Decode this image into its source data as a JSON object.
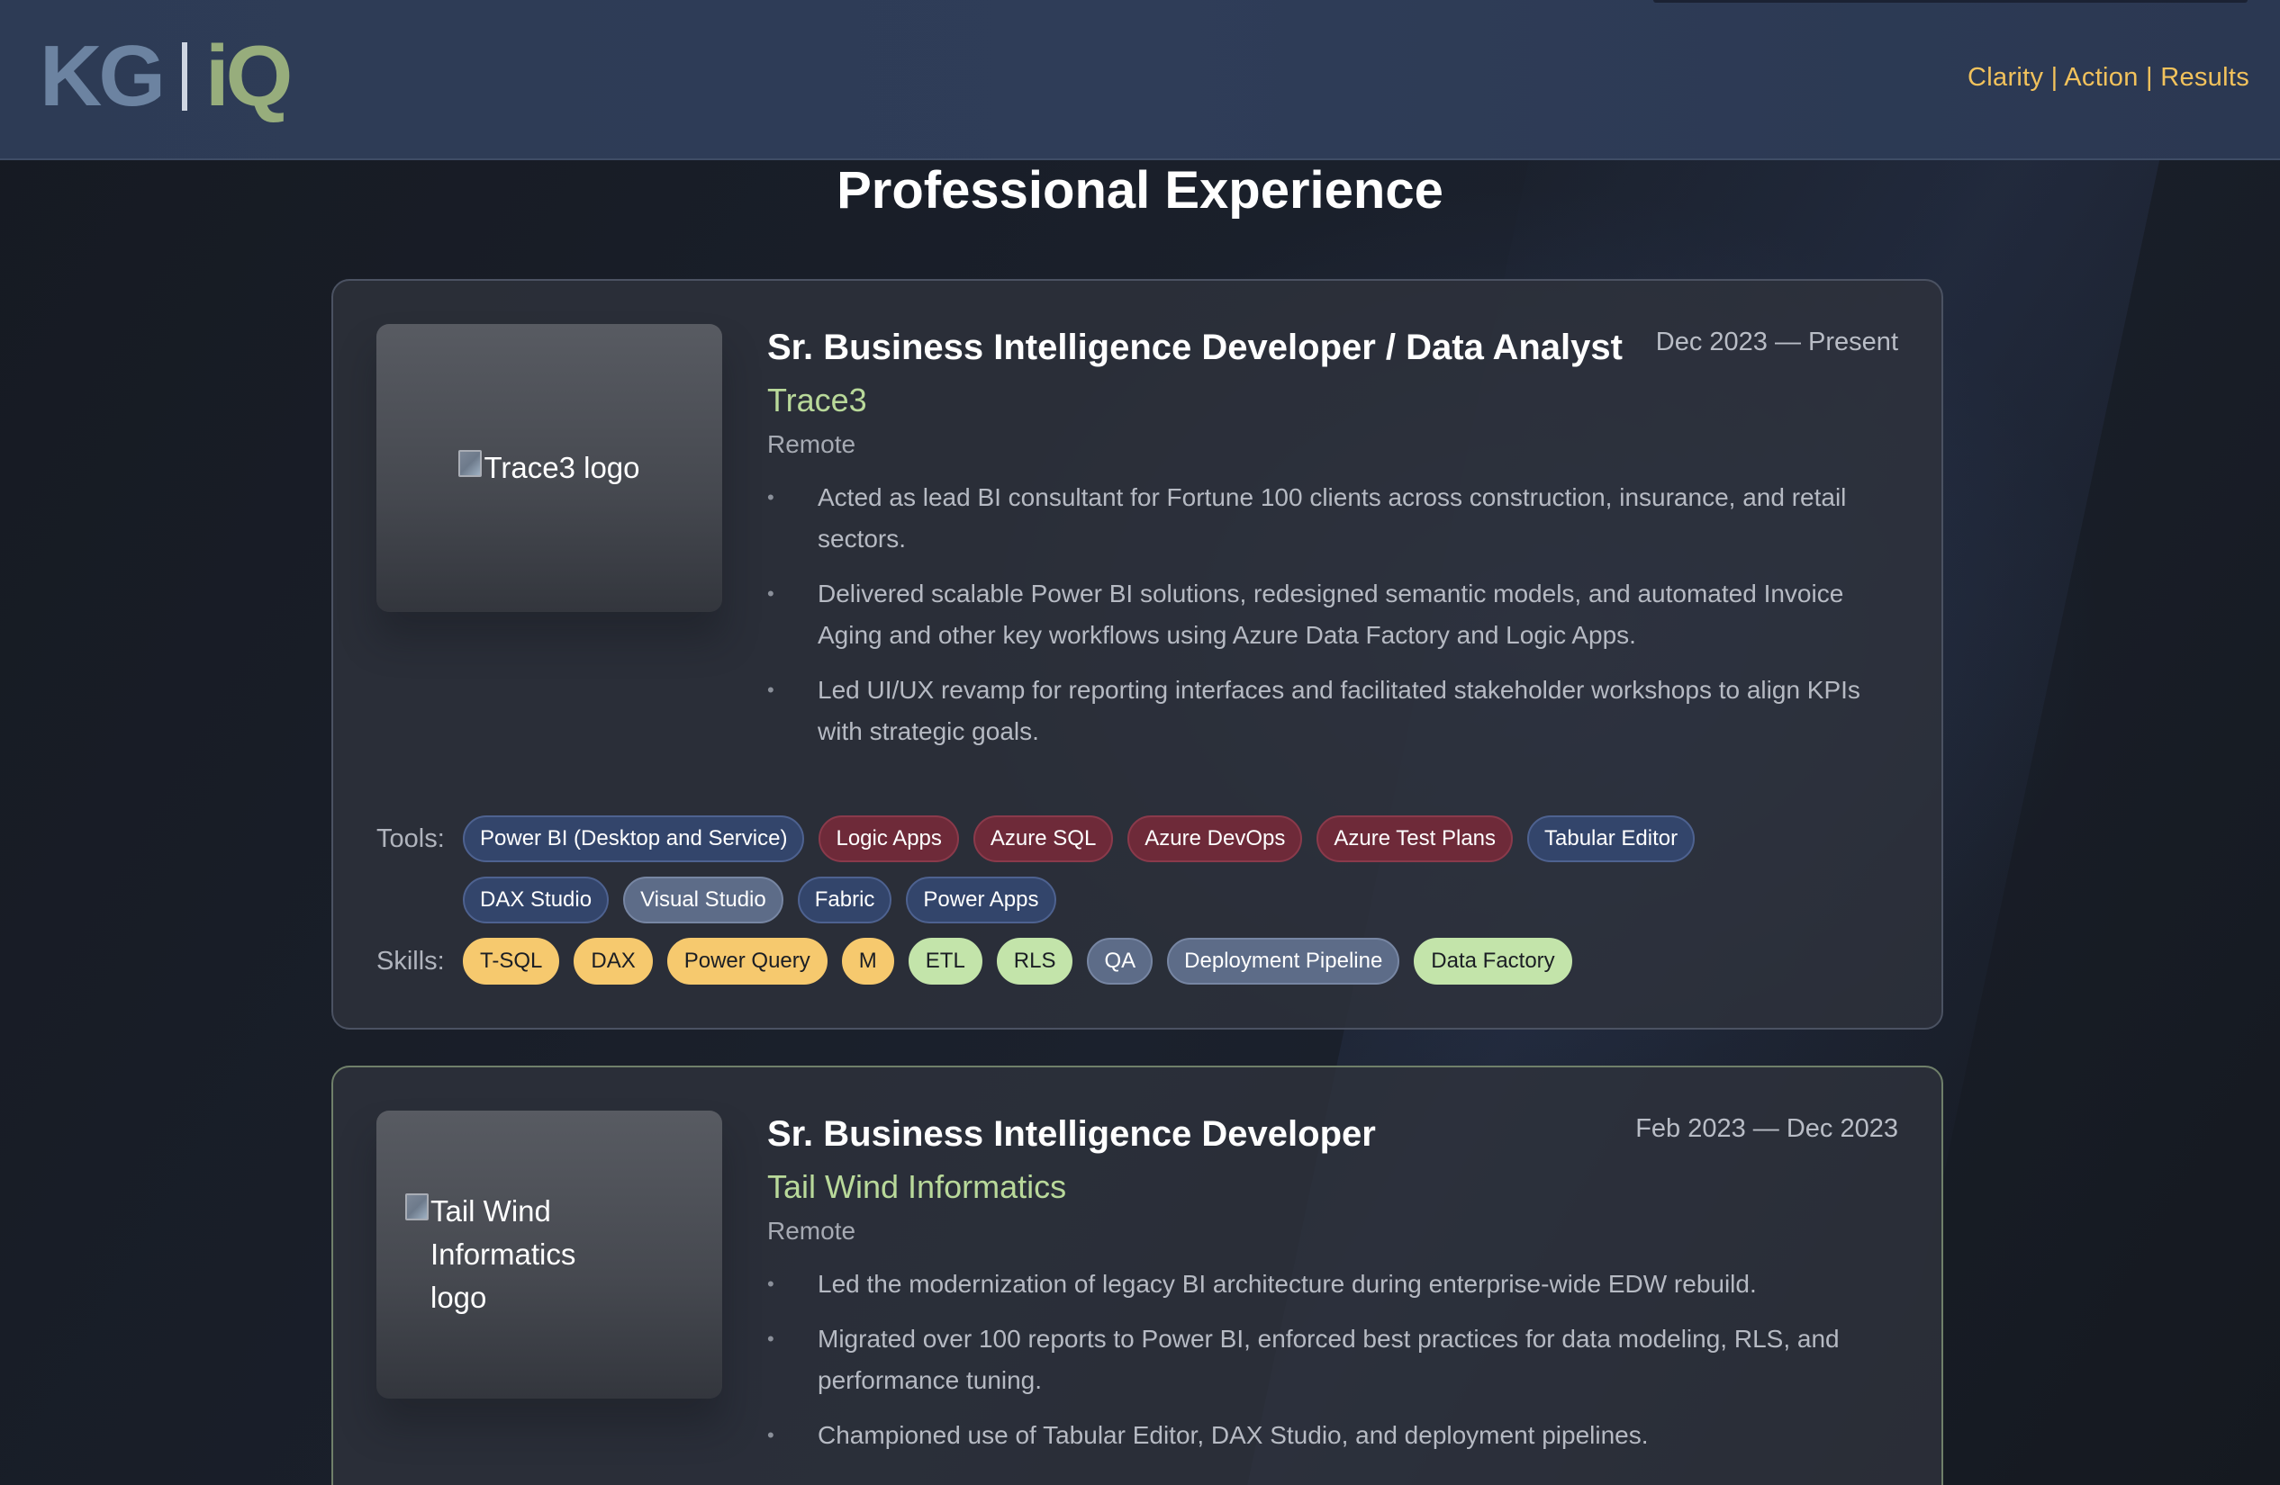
{
  "header": {
    "logo_left": "KG",
    "logo_right": "iQ",
    "tagline": "Clarity | Action | Results"
  },
  "section_title": "Professional Experience",
  "jobs": [
    {
      "logo_alt": "Trace3 logo",
      "title": "Sr. Business Intelligence Developer / Data Analyst",
      "dates": "Dec 2023 — Present",
      "company": "Trace3",
      "location": "Remote",
      "bullets": [
        "Acted as lead BI consultant for Fortune 100 clients across construction, insurance, and retail sectors.",
        "Delivered scalable Power BI solutions, redesigned semantic models, and automated Invoice Aging and other key workflows using Azure Data Factory and Logic Apps.",
        "Led UI/UX revamp for reporting interfaces and facilitated stakeholder workshops to align KPIs with strategic goals."
      ],
      "tools_label": "Tools:",
      "tools": [
        {
          "label": "Power BI (Desktop and Service)",
          "color": "blue"
        },
        {
          "label": "Logic Apps",
          "color": "red"
        },
        {
          "label": "Azure SQL",
          "color": "red"
        },
        {
          "label": "Azure DevOps",
          "color": "red"
        },
        {
          "label": "Azure Test Plans",
          "color": "red"
        },
        {
          "label": "Tabular Editor",
          "color": "blue"
        },
        {
          "label": "DAX Studio",
          "color": "blue"
        },
        {
          "label": "Visual Studio",
          "color": "slate"
        },
        {
          "label": "Fabric",
          "color": "blue"
        },
        {
          "label": "Power Apps",
          "color": "blue"
        }
      ],
      "skills_label": "Skills:",
      "skills": [
        {
          "label": "T-SQL",
          "color": "yellow"
        },
        {
          "label": "DAX",
          "color": "yellow"
        },
        {
          "label": "Power Query",
          "color": "yellow"
        },
        {
          "label": "M",
          "color": "yellow"
        },
        {
          "label": "ETL",
          "color": "green"
        },
        {
          "label": "RLS",
          "color": "green"
        },
        {
          "label": "QA",
          "color": "slate"
        },
        {
          "label": "Deployment Pipeline",
          "color": "slate"
        },
        {
          "label": "Data Factory",
          "color": "green"
        }
      ]
    },
    {
      "logo_alt": "Tail Wind Informatics logo",
      "title": "Sr. Business Intelligence Developer",
      "dates": "Feb 2023 — Dec 2023",
      "company": "Tail Wind Informatics",
      "location": "Remote",
      "bullets": [
        "Led the modernization of legacy BI architecture during enterprise-wide EDW rebuild.",
        "Migrated over 100 reports to Power BI, enforced best practices for data modeling, RLS, and performance tuning.",
        "Championed use of Tabular Editor, DAX Studio, and deployment pipelines."
      ]
    }
  ],
  "colors": {
    "accent_yellow": "#f2c25c",
    "company_green": "#b9d99a",
    "header_bg": "#2f3d58"
  }
}
